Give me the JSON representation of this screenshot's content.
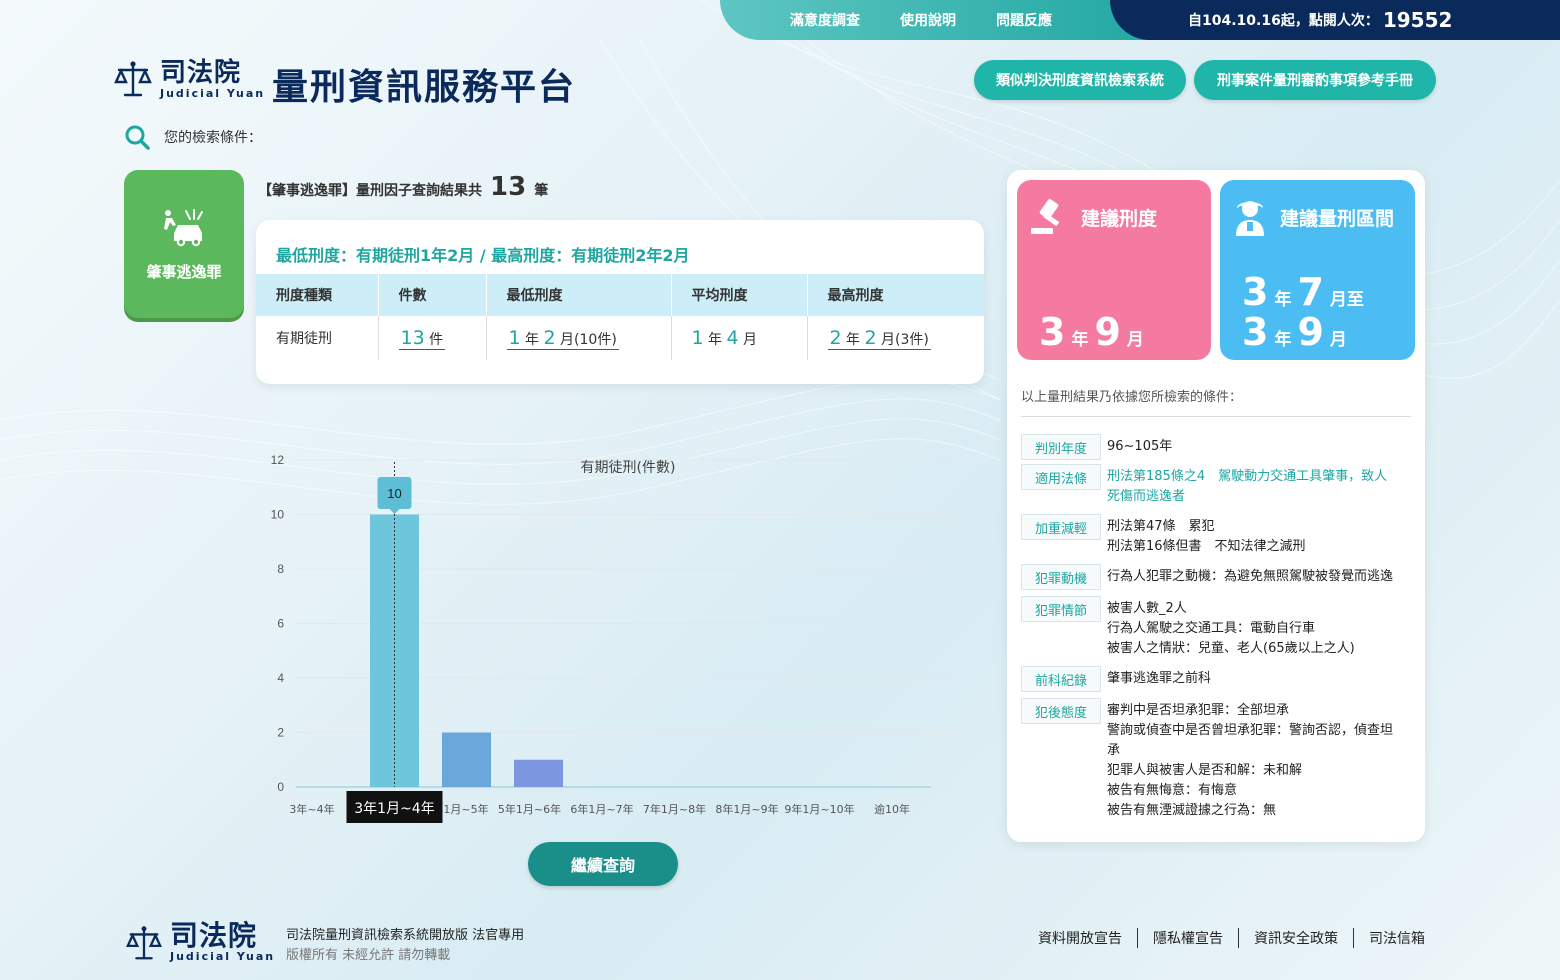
{
  "topnav": {
    "links": [
      "滿意度調查",
      "使用說明",
      "問題反應"
    ],
    "visitor_label": "自104.10.16起，點閱人次：",
    "visitor_count": "19552"
  },
  "header": {
    "logo_zh": "司法院",
    "logo_en": "Judicial Yuan",
    "title": "量刑資訊服務平台",
    "btn_similar": "類似判決刑度資訊檢索系統",
    "btn_manual": "刑事案件量刑審酌事項參考手冊"
  },
  "search": {
    "label": "您的檢索條件："
  },
  "crime": {
    "label": "肇事逃逸罪"
  },
  "result": {
    "prefix": "【肇事逃逸罪】量刑因子查詢結果共",
    "count": "13",
    "suffix": "筆"
  },
  "summary": {
    "range_text": "最低刑度：有期徒刑1年2月  /  最高刑度：有期徒刑2年2月",
    "columns": [
      "刑度種類",
      "件數",
      "最低刑度",
      "平均刑度",
      "最高刑度"
    ],
    "row": {
      "type": "有期徒刑",
      "count_num": "13",
      "count_unit": "件",
      "min_y": "1",
      "min_m": "2",
      "min_cases": "月(10件)",
      "avg_y": "1",
      "avg_m": "4",
      "max_y": "2",
      "max_m": "2",
      "max_cases": "月(3件)",
      "unit_year": "年",
      "unit_month": "月"
    }
  },
  "chart_data": {
    "type": "bar",
    "title": "有期徒刑(件數)",
    "categories": [
      "3年~4年",
      "3年1月~4年",
      "4年1月~5年",
      "5年1月~6年",
      "6年1月~7年",
      "7年1月~8年",
      "8年1月~9年",
      "9年1月~10年",
      "逾10年"
    ],
    "values": [
      10,
      2,
      1,
      0,
      0,
      0,
      0,
      0,
      0
    ],
    "colors": [
      "#6ec6dd",
      "#6aa8dc",
      "#7d96e0"
    ],
    "ylim": [
      0,
      12
    ],
    "yticks": [
      0,
      2,
      4,
      6,
      8,
      10,
      12
    ],
    "tooltip_value": "10",
    "tooltip_category": "3年1月~4年",
    "grid": true
  },
  "continue_btn": "繼續查詢",
  "recommend": {
    "sentence_label": "建議刑度",
    "sentence_y": "3",
    "sentence_m": "9",
    "range_label": "建議量刑區間",
    "range_from_y": "3",
    "range_from_m": "7",
    "range_to": "月至",
    "range_to_y": "3",
    "range_to_m": "9",
    "unit_year": "年",
    "unit_month": "月"
  },
  "basis": {
    "title": "以上量刑結果乃依據您所檢索的條件：",
    "conditions": [
      {
        "tag": "判別年度",
        "lines": [
          "96~105年"
        ],
        "teal": false
      },
      {
        "tag": "適用法條",
        "lines": [
          "刑法第185條之4　駕駛動力交通工具肇事，致人",
          "死傷而逃逸者"
        ],
        "teal": true
      },
      {
        "tag": "加重減輕",
        "lines": [
          "刑法第47條　累犯",
          "刑法第16條但書　不知法律之減刑"
        ],
        "teal": false
      },
      {
        "tag": "犯罪動機",
        "lines": [
          "行為人犯罪之動機：為避免無照駕駛被發覺而逃逸"
        ],
        "teal": false
      },
      {
        "tag": "犯罪情節",
        "lines": [
          "被害人數_2人",
          "行為人駕駛之交通工具：電動自行車",
          "被害人之情狀：兒童、老人(65歲以上之人)"
        ],
        "teal": false
      },
      {
        "tag": "前科紀錄",
        "lines": [
          "肇事逃逸罪之前科"
        ],
        "teal": false
      },
      {
        "tag": "犯後態度",
        "lines": [
          "審判中是否坦承犯罪：全部坦承",
          "警詢或偵查中是否曾坦承犯罪：警詢否認，偵查坦",
          "承",
          "犯罪人與被害人是否和解：未和解",
          "被告有無悔意：有悔意",
          "被告有無湮滅證據之行為：無"
        ],
        "teal": false
      }
    ]
  },
  "footer": {
    "logo_zh": "司法院",
    "logo_en": "Judicial Yuan",
    "line1": "司法院量刑資訊檢索系統開放版 法官專用",
    "line2": "版權所有 未經允許 請勿轉載",
    "links": [
      "資料開放宣告",
      "隱私權宣告",
      "資訊安全政策",
      "司法信箱"
    ]
  },
  "colors": {
    "teal": "#1fa6a1",
    "navy": "#0b2a5c",
    "green_card": "#5cb85c",
    "pink_card": "#f57aa0",
    "blue_card": "#4bbdf3"
  }
}
